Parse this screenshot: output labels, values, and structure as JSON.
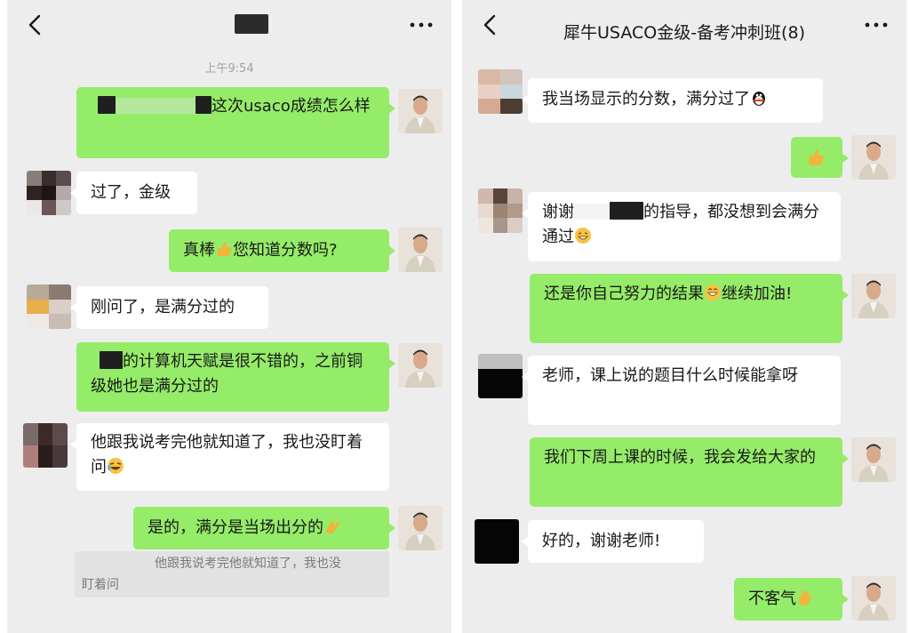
{
  "left": {
    "header": {
      "title": "",
      "time": "上午9:54"
    },
    "messages": [
      {
        "side": "out",
        "pre": "",
        "text": "这次usaco成绩怎么样",
        "post": ""
      },
      {
        "side": "in",
        "pre": "",
        "text": "过了，金级",
        "post": ""
      },
      {
        "side": "out",
        "pre": "真棒",
        "text": "您知道分数吗?",
        "post": ""
      },
      {
        "side": "in",
        "pre": "",
        "text": "刚问了，是满分过的",
        "post": ""
      },
      {
        "side": "out",
        "pre": "",
        "text": "的计算机天赋是很不错的，之前铜级她也是满分过的",
        "post": ""
      },
      {
        "side": "in",
        "pre": "",
        "text": "他跟我说考完他就知道了，我也没盯着问",
        "post": ""
      },
      {
        "side": "out",
        "pre": "",
        "text": "是的，满分是当场出分的",
        "post": ""
      }
    ],
    "quote": {
      "line1": "他跟我说考完他就知道了，我也没",
      "line2": "盯着问"
    }
  },
  "right": {
    "header": {
      "title": "犀牛USACO金级-备考冲刺班(8)"
    },
    "messages": [
      {
        "side": "in",
        "text": "我当场显示的分数，满分过了"
      },
      {
        "side": "out",
        "text": ""
      },
      {
        "side": "in",
        "pre": "谢谢",
        "text": "的指导，都没想到会满分通过"
      },
      {
        "side": "out",
        "text": "还是你自己努力的结果",
        "post": "继续加油!"
      },
      {
        "side": "in",
        "text": "老师，课上说的题目什么时候能拿呀"
      },
      {
        "side": "out",
        "text": "我们下周上课的时候，我会发给大家的"
      },
      {
        "side": "in",
        "text": "好的，谢谢老师!"
      },
      {
        "side": "out",
        "text": "不客气"
      }
    ]
  },
  "icons": [
    "back-arrow-icon",
    "more-dots-icon",
    "thumbs-up-emoji-icon",
    "penguin-emoji-icon",
    "grin-emoji-icon",
    "laugh-cry-emoji-icon",
    "clap-emoji-icon",
    "wave-emoji-icon"
  ],
  "colors": {
    "bg": "#ededed",
    "outgoing_bubble": "#95ec69",
    "incoming_bubble": "#ffffff",
    "text": "#191919",
    "timestamp": "#a3a3a3"
  }
}
